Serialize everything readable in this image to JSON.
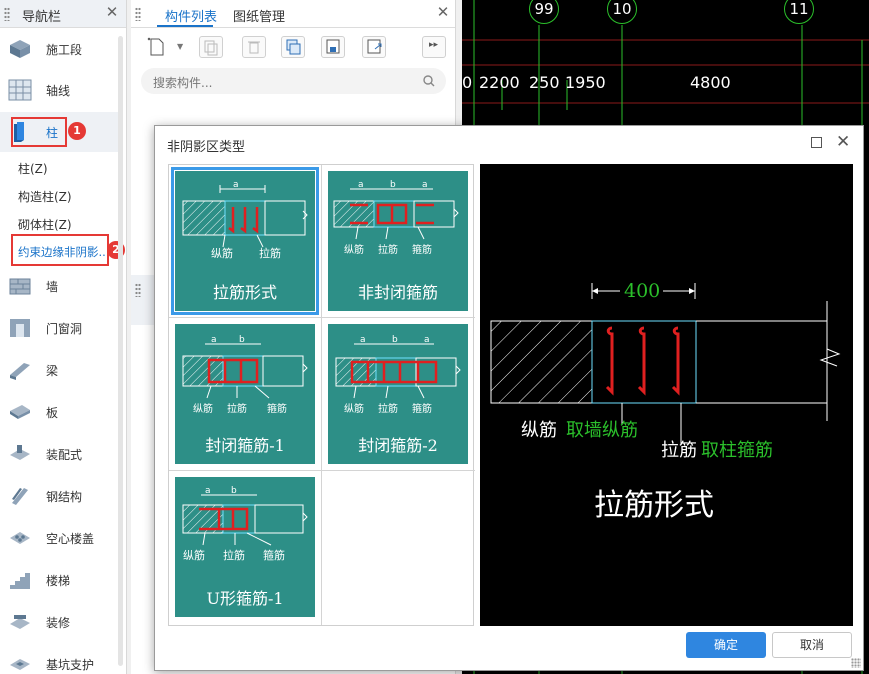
{
  "nav": {
    "title": "导航栏",
    "items": [
      {
        "label": "施工段",
        "icon": "construction-stage-icon"
      },
      {
        "label": "轴线",
        "icon": "axis-grid-icon"
      },
      {
        "label": "柱",
        "icon": "column-icon"
      },
      {
        "label": "墙",
        "icon": "wall-icon"
      },
      {
        "label": "门窗洞",
        "icon": "door-window-icon"
      },
      {
        "label": "梁",
        "icon": "beam-icon"
      },
      {
        "label": "板",
        "icon": "slab-icon"
      },
      {
        "label": "装配式",
        "icon": "prefab-icon"
      },
      {
        "label": "钢结构",
        "icon": "steel-structure-icon"
      },
      {
        "label": "空心楼盖",
        "icon": "hollow-floor-icon"
      },
      {
        "label": "楼梯",
        "icon": "stair-icon"
      },
      {
        "label": "装修",
        "icon": "decoration-icon"
      },
      {
        "label": "基坑支护",
        "icon": "pit-support-icon"
      }
    ],
    "sub_items": [
      "柱(Z)",
      "构造柱(Z)",
      "砌体柱(Z)",
      "约束边缘非阴影..."
    ],
    "badges": [
      "1",
      "2"
    ]
  },
  "component_panel": {
    "tabs": [
      "构件列表",
      "图纸管理"
    ],
    "search_placeholder": "搜索构件..."
  },
  "cad": {
    "axis_numbers": [
      "99",
      "10",
      "11"
    ],
    "dimensions": [
      "0",
      "2200",
      "250",
      "1950",
      "4800"
    ]
  },
  "dialog": {
    "title": "非阴影区类型",
    "tiles": [
      {
        "name": "拉筋形式",
        "labels": [
          "纵筋",
          "拉筋"
        ],
        "dims": [
          "a"
        ]
      },
      {
        "name": "非封闭箍筋",
        "labels": [
          "纵筋",
          "拉筋",
          "箍筋"
        ],
        "dims": [
          "a",
          "b",
          "a"
        ]
      },
      {
        "name": "封闭箍筋-1",
        "labels": [
          "纵筋",
          "拉筋",
          "箍筋"
        ],
        "dims": [
          "a",
          "b"
        ]
      },
      {
        "name": "封闭箍筋-2",
        "labels": [
          "纵筋",
          "拉筋",
          "箍筋"
        ],
        "dims": [
          "a",
          "b",
          "a"
        ]
      },
      {
        "name": "U形箍筋-1",
        "labels": [
          "纵筋",
          "拉筋",
          "箍筋"
        ],
        "dims": [
          "a",
          "b"
        ]
      }
    ],
    "preview": {
      "dimension": "400",
      "label_vertical": "纵筋",
      "label_vertical_note": "取墙纵筋",
      "label_tie": "拉筋",
      "label_tie_note": "取柱箍筋",
      "caption": "拉筋形式"
    },
    "ok_label": "确定",
    "cancel_label": "取消"
  },
  "colors": {
    "tile_bg": "#2d8f87",
    "accent": "#2f86e0",
    "rebar": "#e02020",
    "cad_green": "#2bbf2b",
    "badge": "#e53935"
  }
}
